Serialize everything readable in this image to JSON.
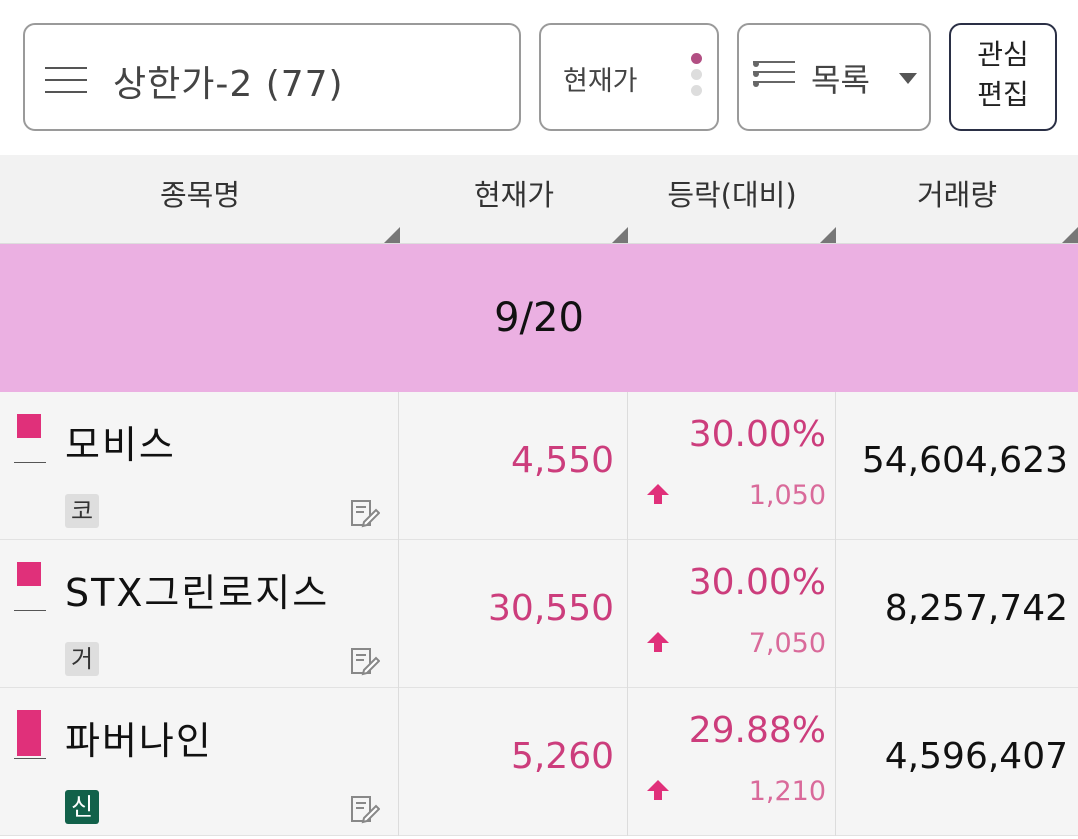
{
  "toolbar": {
    "group_title": "상한가-2 (77)",
    "price_mode_label": "현재가",
    "view_mode_label": "목록",
    "edit_line1": "관심",
    "edit_line2": "편집"
  },
  "table": {
    "headers": [
      "종목명",
      "현재가",
      "등락(대비)",
      "거래량"
    ],
    "date_band": "9/20",
    "rows": [
      {
        "name": "모비스",
        "market": "코",
        "market_style": "gray",
        "price": "4,550",
        "rate": "30.00%",
        "change": "1,050",
        "direction": "up",
        "volume": "54,604,623"
      },
      {
        "name": "STX그린로지스",
        "market": "거",
        "market_style": "gray",
        "price": "30,550",
        "rate": "30.00%",
        "change": "7,050",
        "direction": "up",
        "volume": "8,257,742"
      },
      {
        "name": "파버나인",
        "market": "신",
        "market_style": "green",
        "price": "5,260",
        "rate": "29.88%",
        "change": "1,210",
        "direction": "up",
        "volume": "4,596,407"
      }
    ]
  },
  "colors": {
    "accent_pink": "#cc3d7c",
    "date_band_bg": "#ebb0e2",
    "flag": "#e0307a",
    "market_green": "#12614a"
  },
  "icons": [
    "hamburger-menu-icon",
    "list-view-icon",
    "chevron-down-icon",
    "memo-edit-icon",
    "up-arrow-icon",
    "bookmark-flag-icon"
  ]
}
